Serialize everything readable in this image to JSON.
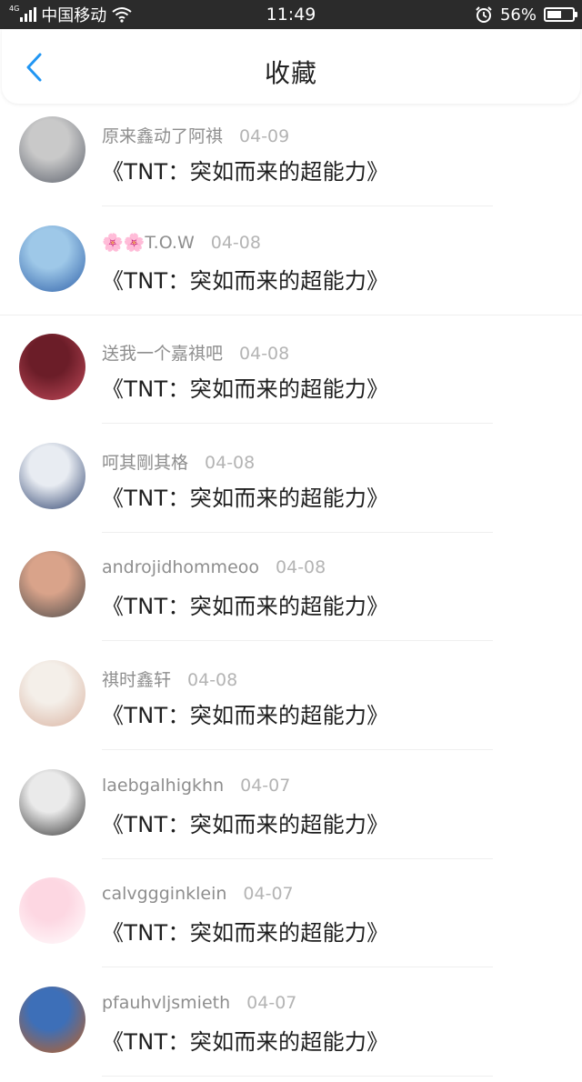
{
  "status_bar": {
    "network": "4G",
    "carrier": "中国移动",
    "time": "11:49",
    "battery_percent": "56%",
    "battery_level": 0.56
  },
  "nav": {
    "title": "收藏",
    "back_icon": "chevron-left-icon"
  },
  "colors": {
    "accent": "#2196f3",
    "username": "#8e8e8e",
    "date": "#b4b4b4"
  },
  "favorites": [
    {
      "user": "原来鑫动了阿祺",
      "date": "04-09",
      "title": "《TNT：突如而来的超能力》",
      "avatar_colors": [
        "#c9c9c9",
        "#5a5f6a"
      ]
    },
    {
      "user": "T.O.W",
      "emoji": "🌸🌸",
      "date": "04-08",
      "title": "《TNT：突如而来的超能力》",
      "avatar_colors": [
        "#9ec8e8",
        "#2d5fa8"
      ]
    },
    {
      "user": "送我一个嘉祺吧",
      "date": "04-08",
      "title": "《TNT：突如而来的超能力》",
      "avatar_colors": [
        "#6b1d28",
        "#c24a5a"
      ]
    },
    {
      "user": "呵其剛其格",
      "date": "04-08",
      "title": "《TNT：突如而来的超能力》",
      "avatar_colors": [
        "#e8ecf2",
        "#2a3f6c"
      ]
    },
    {
      "user": "androjidhommeoo",
      "date": "04-08",
      "title": "《TNT：突如而来的超能力》",
      "avatar_colors": [
        "#d9a38a",
        "#4a4a4a"
      ]
    },
    {
      "user": "祺时鑫轩",
      "date": "04-08",
      "title": "《TNT：突如而来的超能力》",
      "avatar_colors": [
        "#f4efe9",
        "#d9b2a0"
      ]
    },
    {
      "user": "laebgalhigkhn",
      "date": "04-07",
      "title": "《TNT：突如而来的超能力》",
      "avatar_colors": [
        "#eaeaea",
        "#333333"
      ]
    },
    {
      "user": "calvggginklein",
      "date": "04-07",
      "title": "《TNT：突如而来的超能力》",
      "avatar_colors": [
        "#fdd7e2",
        "#ffffff"
      ]
    },
    {
      "user": "pfauhvljsmieth",
      "date": "04-07",
      "title": "《TNT：突如而来的超能力》",
      "avatar_colors": [
        "#3d6fb8",
        "#c2601e"
      ]
    }
  ]
}
